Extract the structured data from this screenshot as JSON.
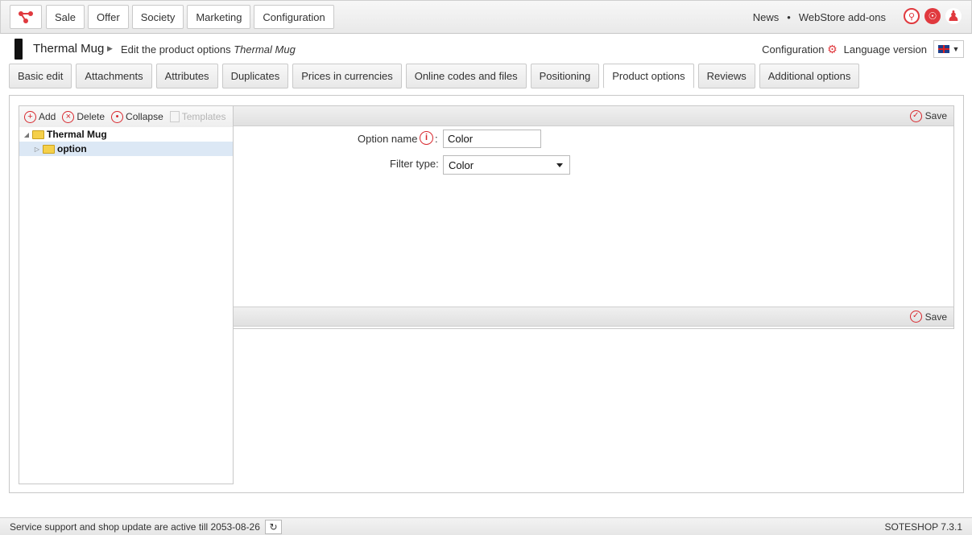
{
  "topbar": {
    "nav": [
      "Sale",
      "Offer",
      "Society",
      "Marketing",
      "Configuration"
    ],
    "links": {
      "news": "News",
      "sep": "•",
      "webstore": "WebStore add-ons"
    },
    "icons": [
      "search-icon",
      "globe-icon",
      "user-icon"
    ]
  },
  "header": {
    "product_name": "Thermal Mug",
    "breadcrumb_prefix": "Edit the product options",
    "breadcrumb_product": "Thermal Mug",
    "config_label": "Configuration",
    "language_label": "Language version"
  },
  "tabs": [
    "Basic edit",
    "Attachments",
    "Attributes",
    "Duplicates",
    "Prices in currencies",
    "Online codes and files",
    "Positioning",
    "Product options",
    "Reviews",
    "Additional options"
  ],
  "active_tab": "Product options",
  "tree": {
    "toolbar": {
      "add": "Add",
      "delete": "Delete",
      "collapse": "Collapse",
      "templates": "Templates"
    },
    "root": "Thermal Mug",
    "child": "option"
  },
  "form": {
    "save_label": "Save",
    "option_name_label": "Option name",
    "option_name_colon": ":",
    "option_name_value": "Color",
    "filter_type_label": "Filter type:",
    "filter_type_value": "Color"
  },
  "footer": {
    "support_text": "Service support and shop update are active till 2053-08-26",
    "version": "SOTESHOP 7.3.1"
  },
  "colors": {
    "accent": "#e0393e",
    "selected_row": "#dce8f5"
  }
}
